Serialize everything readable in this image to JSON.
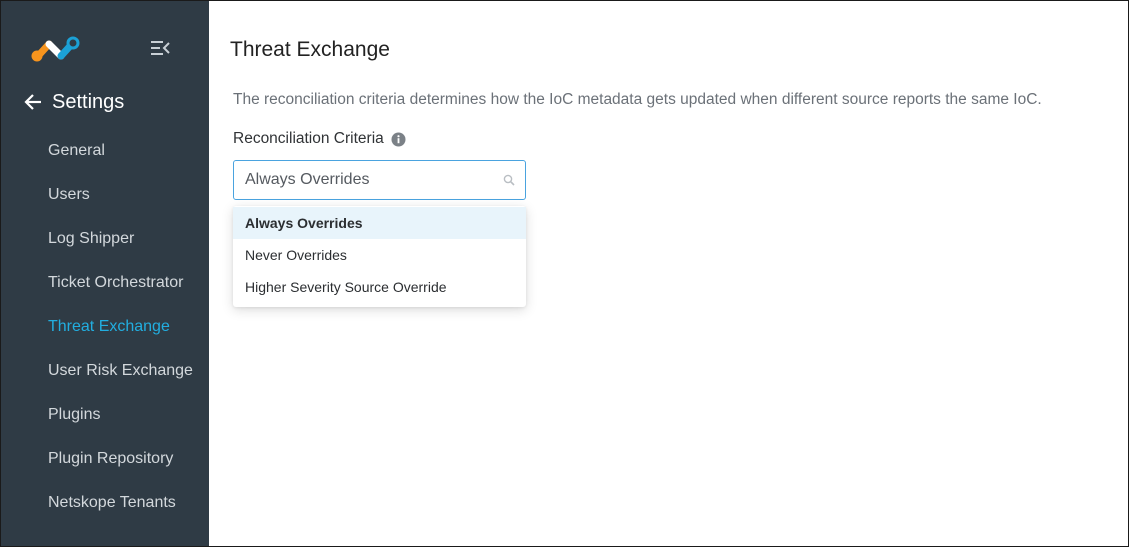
{
  "sidebar": {
    "logo_icon": "netskope-logo-icon",
    "collapse_icon": "menu-collapse-icon",
    "back_icon": "arrow-left-icon",
    "title": "Settings",
    "items": [
      {
        "label": "General",
        "active": false
      },
      {
        "label": "Users",
        "active": false
      },
      {
        "label": "Log Shipper",
        "active": false
      },
      {
        "label": "Ticket Orchestrator",
        "active": false
      },
      {
        "label": "Threat Exchange",
        "active": true
      },
      {
        "label": "User Risk Exchange",
        "active": false
      },
      {
        "label": "Plugins",
        "active": false
      },
      {
        "label": "Plugin Repository",
        "active": false
      },
      {
        "label": "Netskope Tenants",
        "active": false
      }
    ],
    "colors": {
      "background": "#2f3b45",
      "text": "#d3d8dc",
      "active": "#22aee0"
    }
  },
  "main": {
    "title": "Threat Exchange",
    "description": "The reconciliation criteria determines how the IoC metadata gets updated when different source reports the same IoC.",
    "field": {
      "label": "Reconciliation Criteria",
      "info_icon": "info-icon",
      "value": "Always Overrides",
      "search_icon": "search-icon",
      "options": [
        {
          "label": "Always Overrides",
          "selected": true
        },
        {
          "label": "Never Overrides",
          "selected": false
        },
        {
          "label": "Higher Severity Source Override",
          "selected": false
        }
      ]
    }
  }
}
